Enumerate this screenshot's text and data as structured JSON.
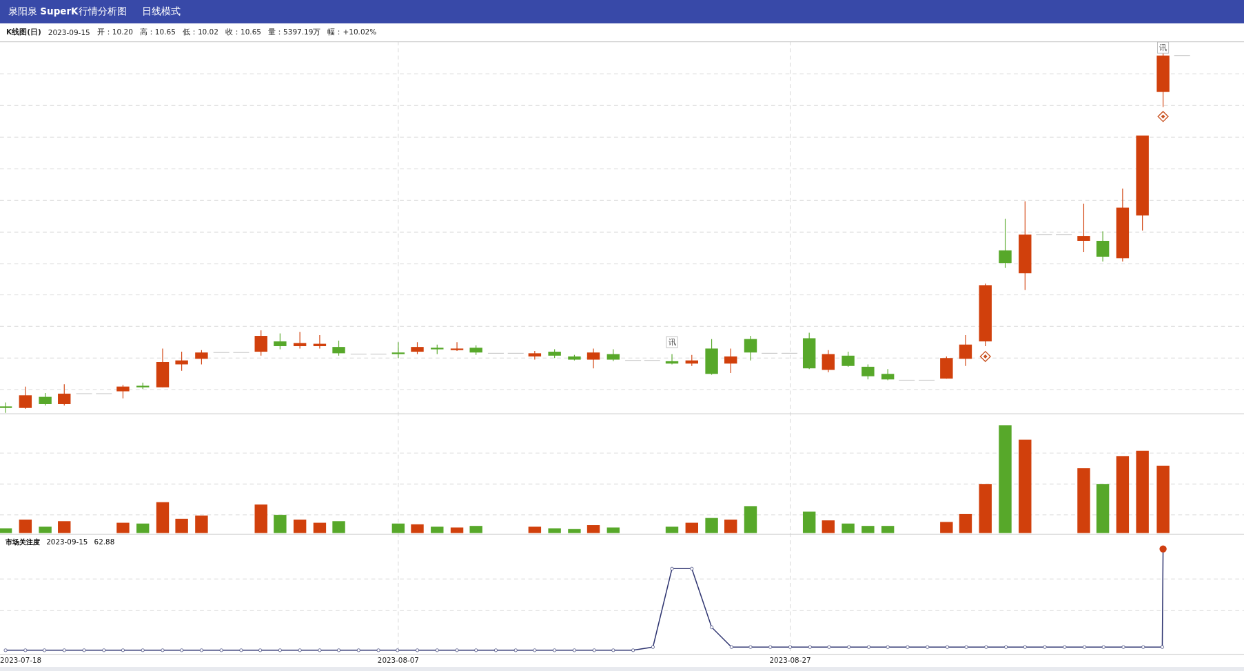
{
  "window": {
    "title": "泉阳泉 **SuperK**行情分析图",
    "mode": "日线模式"
  },
  "kline_header": {
    "title": "K线图(日)",
    "date": "2023-09-15",
    "fields": [
      "开：10.20",
      "高：10.65",
      "低：10.02",
      "收：10.65",
      "量：5397.19万",
      "幅：+10.02%"
    ]
  },
  "news_markers": [
    "讯",
    "讯"
  ],
  "attention": {
    "title": "市场关注度",
    "date": "2023-09-15",
    "value": "62.88"
  },
  "x_axis": {
    "labels": [
      "2023-07-18",
      "2023-08-07",
      "2023-08-27"
    ]
  }
}
